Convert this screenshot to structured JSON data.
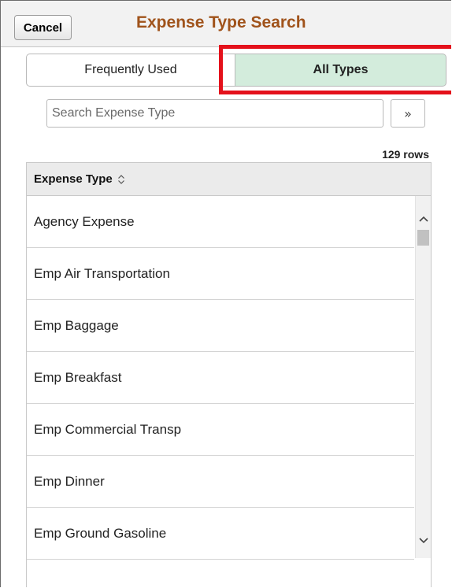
{
  "header": {
    "cancel_label": "Cancel",
    "title": "Expense Type Search"
  },
  "tabs": {
    "frequent_label": "Frequently Used",
    "all_label": "All Types",
    "selected": "All Types"
  },
  "search": {
    "placeholder": "Search Expense Type",
    "value": "",
    "go_label": "»"
  },
  "grid": {
    "row_count": "129 rows",
    "column_header": "Expense Type",
    "rows": [
      "Agency Expense",
      "Emp Air Transportation",
      "Emp Baggage",
      "Emp Breakfast",
      "Emp Commercial Transp",
      "Emp Dinner",
      "Emp Ground Gasoline"
    ]
  },
  "colors": {
    "title": "#a0531b",
    "selected_tab": "#d3ecdc",
    "highlight": "#e4111b"
  },
  "icons": {
    "sort": "sort-updown-icon",
    "go": "double-chevron-right-icon",
    "scroll_up": "chevron-up-icon",
    "scroll_down": "chevron-down-icon"
  }
}
